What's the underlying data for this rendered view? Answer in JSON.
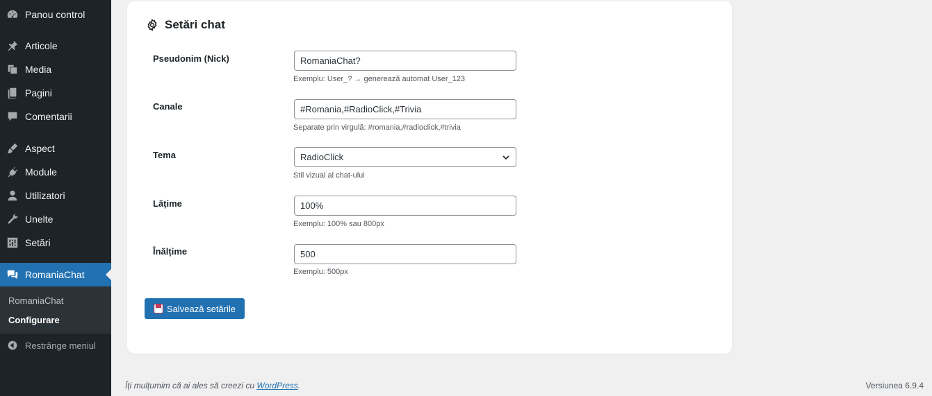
{
  "sidebar": {
    "items": [
      {
        "label": "Panou control",
        "icon": "dashboard-icon"
      },
      {
        "label": "Articole",
        "icon": "pin-icon"
      },
      {
        "label": "Media",
        "icon": "media-icon"
      },
      {
        "label": "Pagini",
        "icon": "pages-icon"
      },
      {
        "label": "Comentarii",
        "icon": "comments-icon"
      },
      {
        "label": "Aspect",
        "icon": "appearance-icon"
      },
      {
        "label": "Module",
        "icon": "plugins-icon"
      },
      {
        "label": "Utilizatori",
        "icon": "users-icon"
      },
      {
        "label": "Unelte",
        "icon": "tools-icon"
      },
      {
        "label": "Setări",
        "icon": "settings-icon"
      },
      {
        "label": "RomaniaChat",
        "icon": "chat-icon"
      }
    ],
    "submenu": [
      "RomaniaChat",
      "Configurare"
    ],
    "collapse_label": "Restrânge meniul"
  },
  "card": {
    "title": "Setări chat",
    "fields": [
      {
        "label": "Pseudonim (Nick)",
        "value": "RomaniaChat?",
        "desc": "Exemplu: User_? → generează automat User_123"
      },
      {
        "label": "Canale",
        "value": "#Romania,#RadioClick,#Trivia",
        "desc": "Separate prin virgulă: #romania,#radioclick,#trivia"
      },
      {
        "label": "Tema",
        "value": "RadioClick",
        "desc": "Stil vizual al chat-ului"
      },
      {
        "label": "Lățime",
        "value": "100%",
        "desc": "Exemplu: 100% sau 800px"
      },
      {
        "label": "Înălțime",
        "value": "500",
        "desc": "Exemplu: 500px"
      }
    ],
    "save_label": "Salvează setările"
  },
  "footer": {
    "thanks_text": "Îți mulțumim că ai ales să creezi cu",
    "wp_link": "WordPress",
    "period": ".",
    "version": "Versiunea 6.9.4"
  },
  "colors": {
    "sidebar_bg": "#1d2327",
    "accent": "#2271b1",
    "page_bg": "#f0f0f1"
  }
}
